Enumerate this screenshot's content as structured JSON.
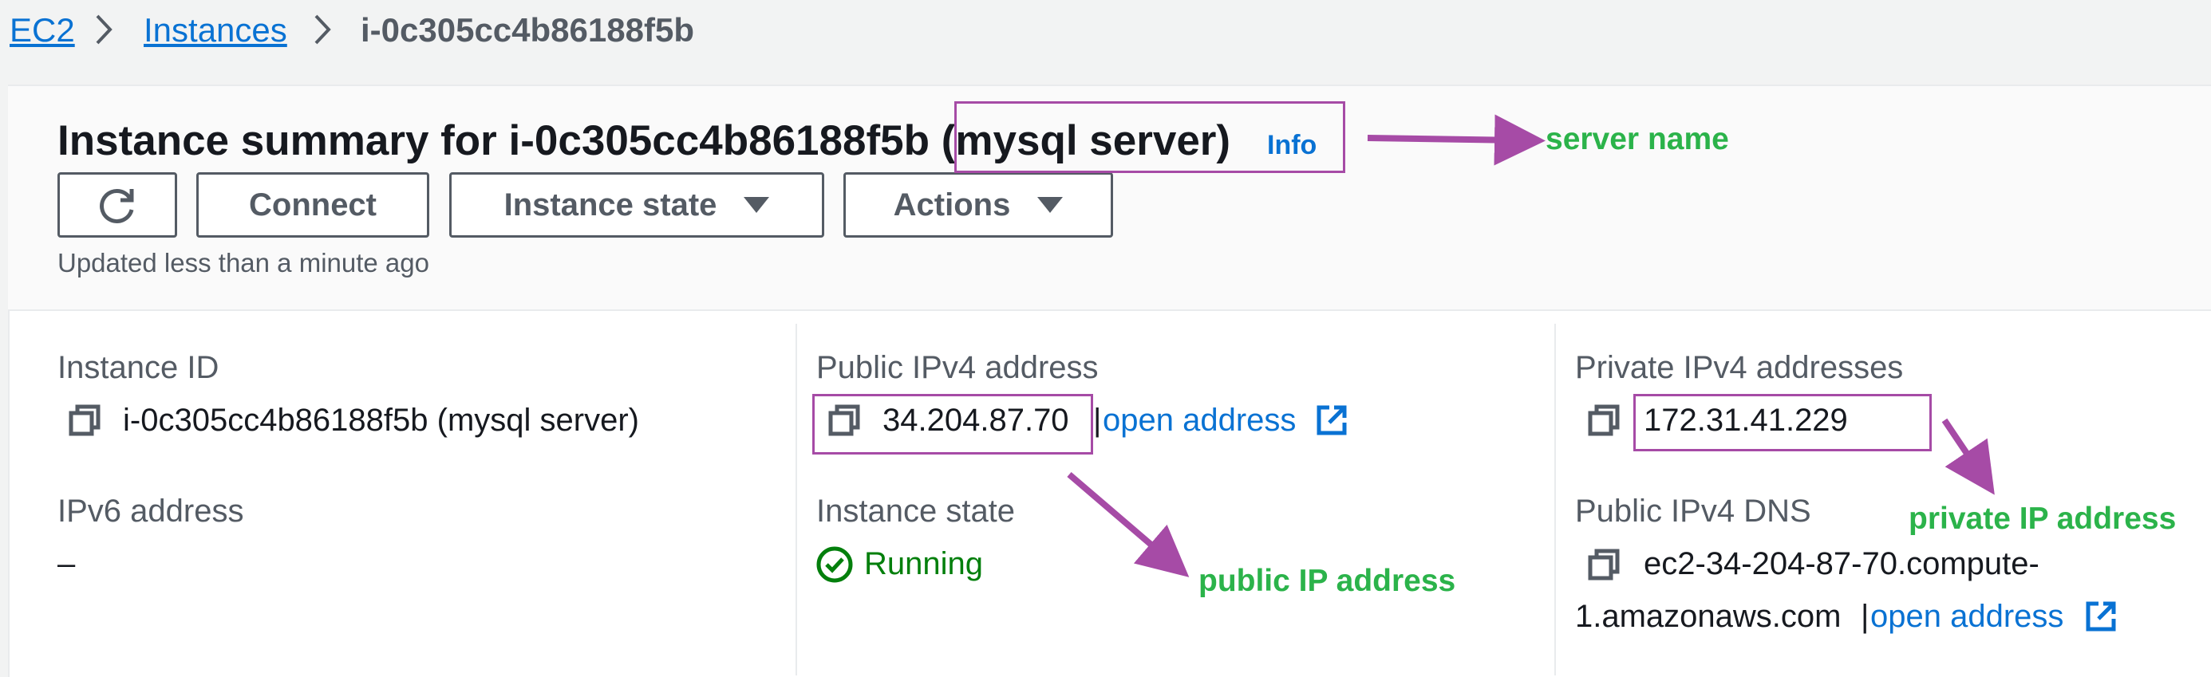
{
  "breadcrumb": {
    "root": "EC2",
    "parent": "Instances",
    "current": "i-0c305cc4b86188f5b"
  },
  "header": {
    "title": "Instance summary for i-0c305cc4b86188f5b",
    "server_name": "(mysql server)",
    "info": "Info",
    "updated": "Updated less than a minute ago"
  },
  "toolbar": {
    "refresh_icon": "refresh-icon",
    "connect": "Connect",
    "instance_state": "Instance state",
    "actions": "Actions"
  },
  "details": {
    "instance_id_label": "Instance ID",
    "instance_id_value": "i-0c305cc4b86188f5b (mysql server)",
    "ipv6_label": "IPv6 address",
    "ipv6_value": "–",
    "public_ipv4_label": "Public IPv4 address",
    "public_ipv4_value": "34.204.87.70",
    "separator": "|",
    "open_address": "open address",
    "instance_state_label": "Instance state",
    "instance_state_value": "Running",
    "private_ipv4_label": "Private IPv4 addresses",
    "private_ipv4_value": "172.31.41.229",
    "public_dns_label": "Public IPv4 DNS",
    "public_dns_line1": "ec2-34-204-87-70.compute-",
    "public_dns_line2": "1.amazonaws.com"
  },
  "annotations": {
    "server_name": "server name",
    "public_ip": "public IP address",
    "private_ip": "private IP address"
  },
  "colors": {
    "link": "#0972d3",
    "annotation_box": "#a64ba6",
    "annotation_text": "#2bb34a",
    "running": "#037f0c"
  }
}
